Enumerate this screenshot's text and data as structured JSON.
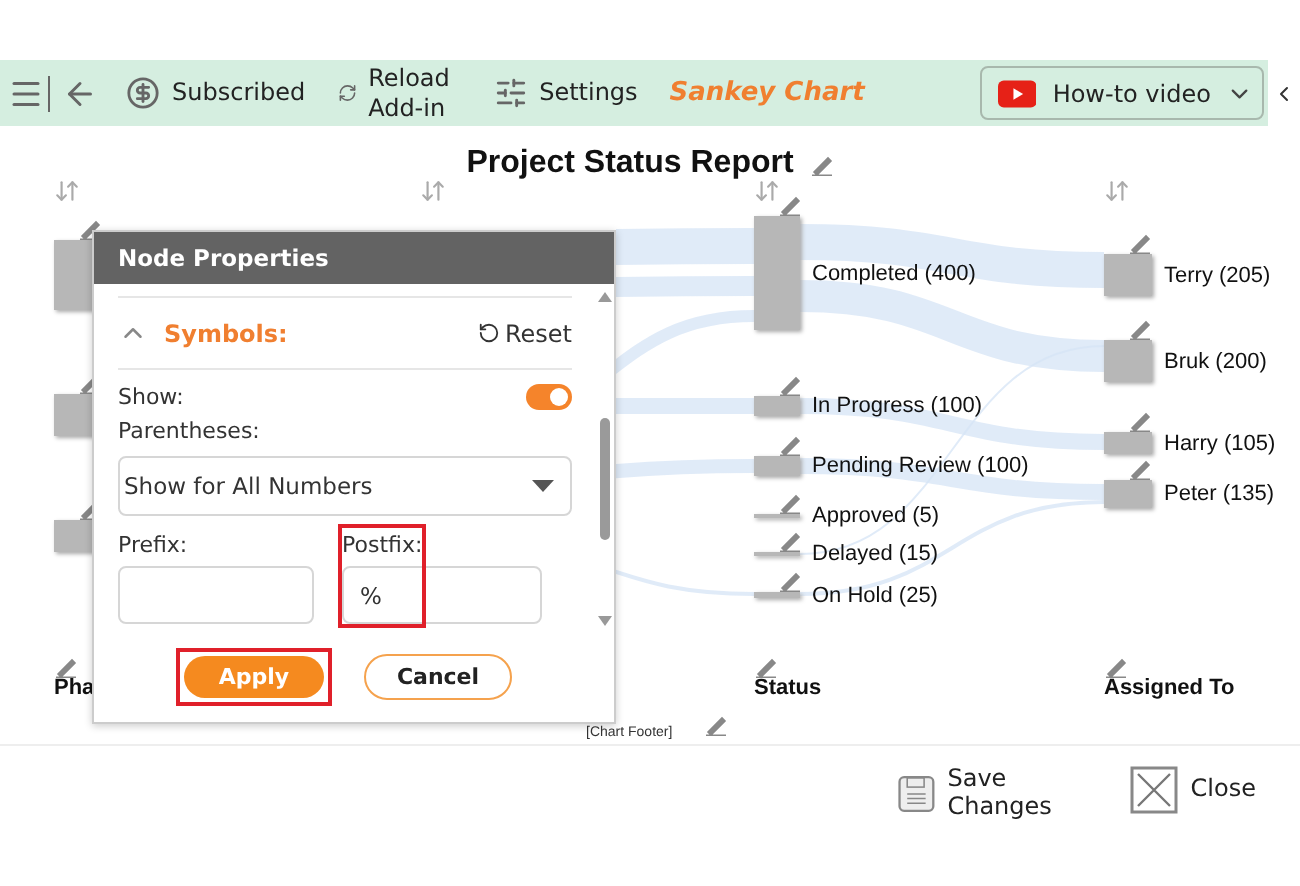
{
  "toolbar": {
    "items": [
      {
        "kind": "menu"
      },
      {
        "kind": "back"
      },
      {
        "kind": "subscribed",
        "label": "Subscribed"
      },
      {
        "kind": "reload",
        "label": "Reload Add-in"
      },
      {
        "kind": "settings",
        "label": "Settings"
      }
    ],
    "app_title": "Sankey Chart",
    "video_button": "How-to video"
  },
  "chart": {
    "title": "Project Status Report",
    "footer": "[Chart Footer]",
    "columns": [
      {
        "label": "Pha"
      },
      {
        "label": "Status",
        "nodes": [
          {
            "label": "Completed (400)"
          },
          {
            "label": "In Progress (100)"
          },
          {
            "label": "Pending Review (100)"
          },
          {
            "label": "Approved (5)"
          },
          {
            "label": "Delayed (15)"
          },
          {
            "label": "On Hold (25)"
          }
        ]
      },
      {
        "label": "Assigned To",
        "nodes": [
          {
            "label": "Terry (205)"
          },
          {
            "label": "Bruk (200)"
          },
          {
            "label": "Harry (105)"
          },
          {
            "label": "Peter (135)"
          }
        ]
      }
    ]
  },
  "dialog": {
    "title": "Node Properties",
    "section": {
      "label": "Symbols:",
      "expanded": true,
      "reset": "Reset"
    },
    "show": {
      "label": "Show:",
      "on": true
    },
    "parentheses": {
      "label": "Parentheses:",
      "value": "Show for All Numbers"
    },
    "prefix": {
      "label": "Prefix:"
    },
    "postfix": {
      "label": "Postfix:",
      "value": "%",
      "highlighted": true
    },
    "apply": {
      "label": "Apply",
      "highlighted": true
    },
    "cancel": {
      "label": "Cancel"
    }
  },
  "bottom_bar": {
    "save": "Save Changes",
    "close": "Close"
  }
}
